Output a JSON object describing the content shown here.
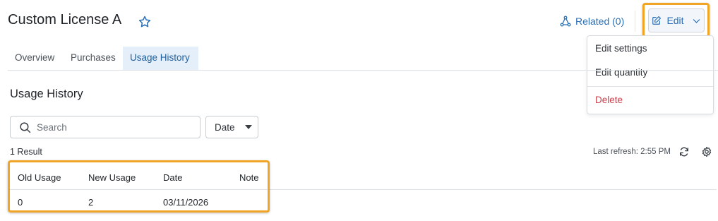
{
  "header": {
    "title": "Custom License A",
    "related_label": "Related (0)",
    "edit_label": "Edit"
  },
  "edit_menu": {
    "items": [
      {
        "label": "Edit settings"
      },
      {
        "label": "Edit quantity"
      },
      {
        "label": "Delete",
        "color": "#c8414d"
      }
    ]
  },
  "tabs": [
    {
      "label": "Overview",
      "active": false
    },
    {
      "label": "Purchases",
      "active": false
    },
    {
      "label": "Usage History",
      "active": true
    }
  ],
  "section": {
    "title": "Usage History"
  },
  "search": {
    "placeholder": "Search",
    "value": ""
  },
  "filter": {
    "date_label": "Date"
  },
  "results": {
    "count_label": "1 Result",
    "last_refresh": "Last refresh: 2:55 PM"
  },
  "table": {
    "columns": [
      "Old Usage",
      "New Usage",
      "Date",
      "Note"
    ],
    "rows": [
      [
        "0",
        "2",
        "03/11/2026",
        ""
      ]
    ]
  },
  "colors": {
    "accent": "#2a6fb5",
    "highlight": "#f0a526",
    "danger": "#c8414d",
    "active_tab_bg": "#e4eff9"
  },
  "icons": [
    "star-icon",
    "related-icon",
    "edit-icon",
    "chevron-down-icon",
    "search-icon",
    "caret-down-icon",
    "refresh-icon",
    "gear-icon"
  ]
}
